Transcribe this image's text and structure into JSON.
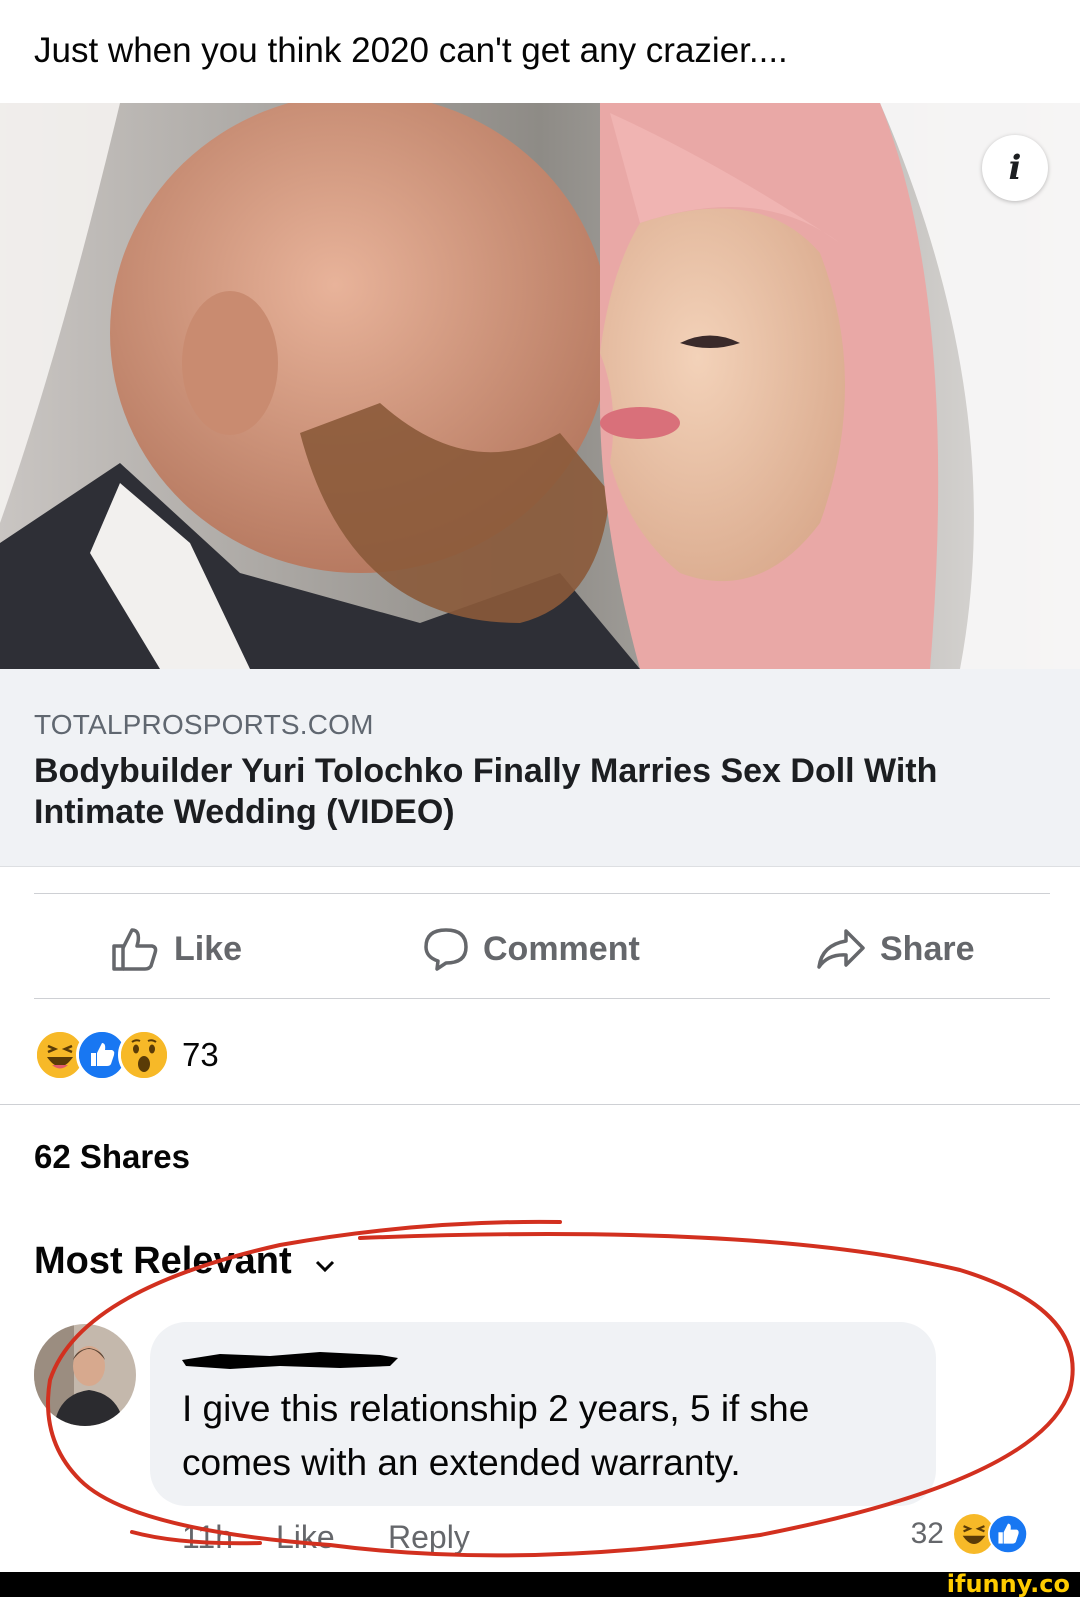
{
  "post": {
    "text": "Just when you think 2020 can't get any crazier...."
  },
  "link_preview": {
    "domain": "TOTALPROSPORTS.COM",
    "title": "Bodybuilder Yuri Tolochko Finally Marries Sex Doll With Intimate Wedding (VIDEO)",
    "image_icon": "photo-kissing-couple",
    "info_icon": "info-icon"
  },
  "actions": {
    "like_label": "Like",
    "comment_label": "Comment",
    "share_label": "Share"
  },
  "reactions": {
    "icons": [
      "haha-icon",
      "like-icon",
      "wow-icon"
    ],
    "count": "73"
  },
  "shares": "62 Shares",
  "comments_section": {
    "sort_label": "Most Relevant"
  },
  "comment": {
    "text": "I give this relationship 2 years, 5 if she comes with an extended warranty.",
    "time": "11h",
    "like_label": "Like",
    "reply_label": "Reply",
    "reaction_count": "32"
  },
  "colors": {
    "facebook_blue": "#1877f2",
    "action_gray": "#65676b",
    "annotation_red": "#d2301f",
    "haha_yellow": "#f7b928"
  },
  "watermark": "ifunny.co"
}
